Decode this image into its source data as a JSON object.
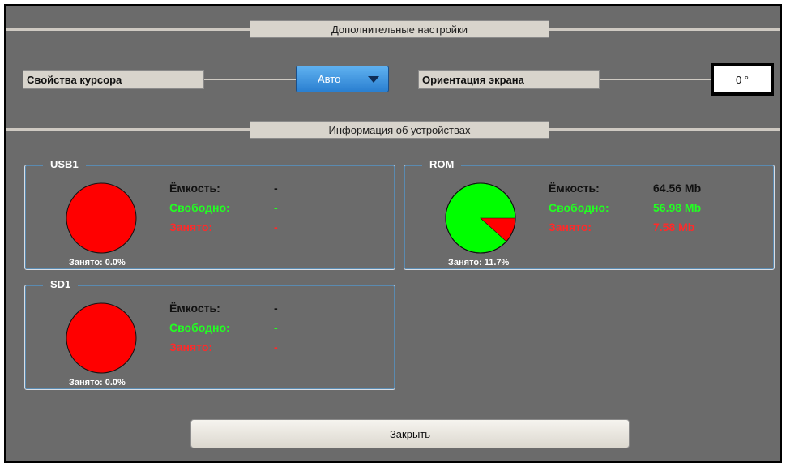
{
  "sections": {
    "advanced_settings": "Дополнительные настройки",
    "device_info": "Информация об устройствах"
  },
  "settings": {
    "cursor_label": "Свойства курсора",
    "cursor_value": "Авто",
    "orientation_label": "Ориентация экрана",
    "orientation_value": "0 °"
  },
  "stat_labels": {
    "capacity": "Ёмкость:",
    "free": "Свободно:",
    "used": "Занято:"
  },
  "devices": [
    {
      "name": "USB1",
      "capacity": "-",
      "free": "-",
      "used": "-",
      "used_caption": "Занято: 0.0%",
      "used_fraction": 0.0,
      "no_media": true
    },
    {
      "name": "ROM",
      "capacity": "64.56 Mb",
      "free": "56.98 Mb",
      "used": "7.58 Mb",
      "used_caption": "Занято: 11.7%",
      "used_fraction": 0.117,
      "no_media": false
    },
    {
      "name": "SD1",
      "capacity": "-",
      "free": "-",
      "used": "-",
      "used_caption": "Занято: 0.0%",
      "used_fraction": 0.0,
      "no_media": true
    }
  ],
  "colors": {
    "free": "#00ff00",
    "used": "#ff0000"
  },
  "close_label": "Закрыть"
}
